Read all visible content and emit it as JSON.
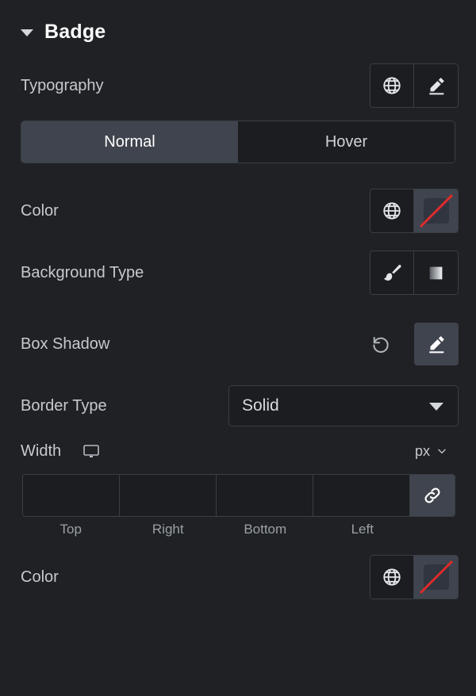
{
  "section": {
    "title": "Badge",
    "collapse_icon": "caret-down-icon",
    "expanded": true
  },
  "rows": {
    "typography": {
      "label": "Typography",
      "globe_icon": "globe-icon",
      "edit_icon": "pencil-icon"
    },
    "state_tabs": {
      "tabs": [
        {
          "label": "Normal",
          "active": true
        },
        {
          "label": "Hover",
          "active": false
        }
      ]
    },
    "color": {
      "label": "Color",
      "globe_icon": "globe-icon",
      "swatch_icon": "no-color-swatch-icon",
      "swatch_value": "",
      "swatch_slash_color": "#e02b2b"
    },
    "background_type": {
      "label": "Background Type",
      "options": [
        {
          "icon": "brush-icon",
          "name": "classic"
        },
        {
          "icon": "gradient-icon",
          "name": "gradient"
        }
      ]
    },
    "box_shadow": {
      "label": "Box Shadow",
      "reset_icon": "reset-icon",
      "edit_icon": "pencil-icon",
      "edit_active": true
    },
    "border_type": {
      "label": "Border Type",
      "value": "Solid",
      "caret_icon": "caret-down-icon"
    },
    "width": {
      "label": "Width",
      "device_icon": "desktop-icon",
      "unit": "px",
      "unit_caret_icon": "chevron-down-icon",
      "link_icon": "link-icon",
      "link_active": true,
      "fields": [
        {
          "label": "Top",
          "value": "",
          "placeholder": ""
        },
        {
          "label": "Right",
          "value": "",
          "placeholder": ""
        },
        {
          "label": "Bottom",
          "value": "",
          "placeholder": ""
        },
        {
          "label": "Left",
          "value": "",
          "placeholder": ""
        }
      ]
    },
    "border_color": {
      "label": "Color",
      "globe_icon": "globe-icon",
      "swatch_icon": "no-color-swatch-icon",
      "swatch_value": "",
      "swatch_slash_color": "#e02b2b"
    }
  },
  "colors": {
    "panel_bg": "#1f2124",
    "control_bg": "#1b1d20",
    "active_bg": "#40444e",
    "border": "#3a3f45",
    "text": "#c6cace",
    "title": "#ffffff",
    "muted": "#9aa0a6"
  }
}
